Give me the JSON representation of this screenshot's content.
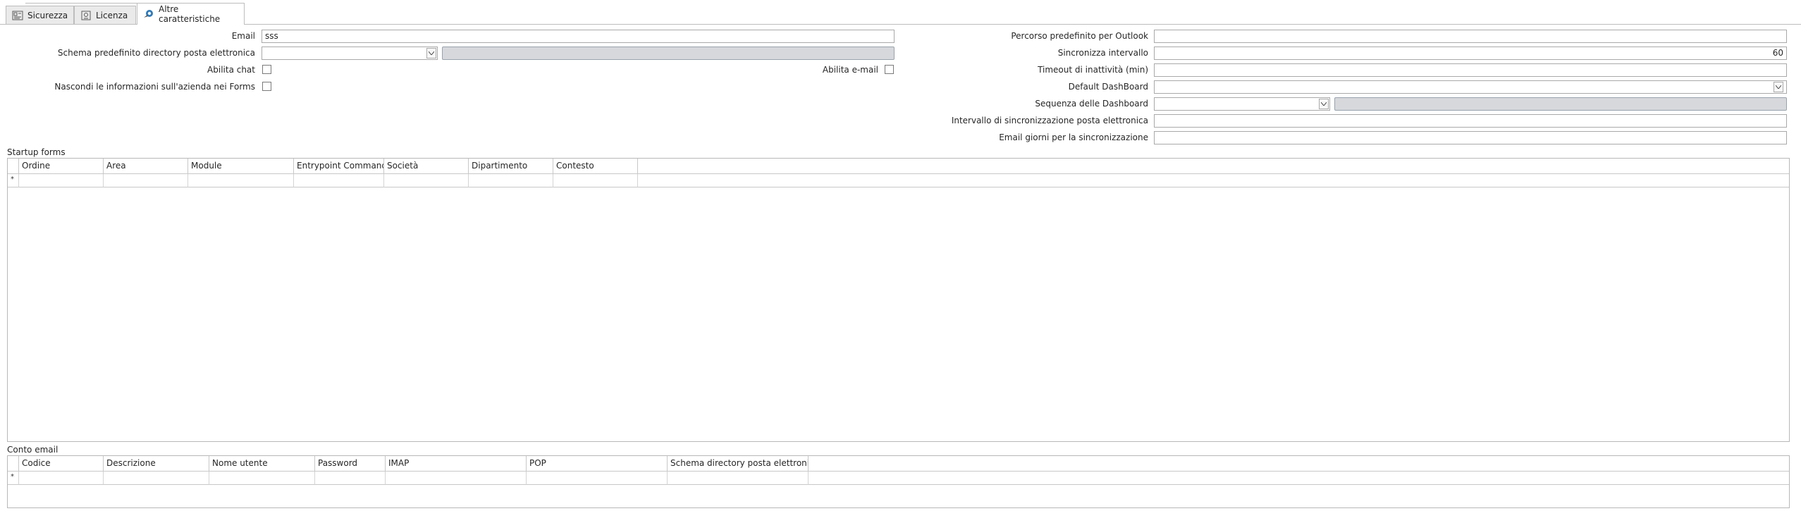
{
  "tabs": [
    {
      "label": "Sicurezza",
      "icon": "security-icon",
      "active": false
    },
    {
      "label": "Licenza",
      "icon": "license-icon",
      "active": false
    },
    {
      "label": "Altre caratteristiche",
      "icon": "features-icon",
      "active": true
    }
  ],
  "left_form": {
    "email_label": "Email",
    "email_value": "sss",
    "schema_label": "Schema predefinito directory posta elettronica",
    "schema_value": "",
    "abilita_chat_label": "Abilita chat",
    "abilita_chat_checked": false,
    "abilita_email_label": "Abilita e-mail",
    "abilita_email_checked": false,
    "nascondi_label": "Nascondi le informazioni sull'azienda nei Forms",
    "nascondi_checked": false
  },
  "right_form": {
    "outlook_label": "Percorso predefinito per Outlook",
    "outlook_value": "",
    "sync_interval_label": "Sincronizza intervallo",
    "sync_interval_value": "60",
    "timeout_label": "Timeout di inattività (min)",
    "timeout_value": "",
    "default_dashboard_label": "Default DashBoard",
    "default_dashboard_value": "",
    "dashboard_seq_label": "Sequenza delle Dashboard",
    "dashboard_seq_value": "",
    "mail_sync_interval_label": "Intervallo di sincronizzazione posta elettronica",
    "mail_sync_interval_value": "",
    "mail_days_label": "Email giorni per la sincronizzazione",
    "mail_days_value": ""
  },
  "startup_forms": {
    "title": "Startup forms",
    "columns": [
      "Ordine",
      "Area",
      "Module",
      "Entrypoint Commands",
      "Società",
      "Dipartimento",
      "Contesto"
    ],
    "new_row_marker": "*"
  },
  "conto_email": {
    "title": "Conto email",
    "columns": [
      "Codice",
      "Descrizione",
      "Nome utente",
      "Password",
      "IMAP",
      "POP",
      "Schema directory posta elettronica"
    ],
    "new_row_marker": "*"
  }
}
